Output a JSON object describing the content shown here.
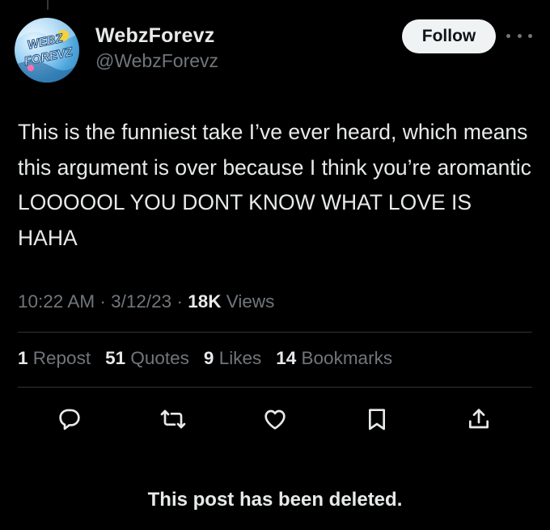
{
  "user": {
    "display_name": "WebzForevz",
    "handle": "@WebzForevz",
    "avatar_icon": "webzforevz-logo-avatar"
  },
  "follow_label": "Follow",
  "more_icon": "more-horizontal-icon",
  "tweet": {
    "text": "This is the funniest take I’ve ever heard, which means this argument is over because I think you’re aromantic LOOOOOL YOU DONT KNOW WHAT LOVE IS HAHA"
  },
  "meta": {
    "time": "10:22 AM",
    "separator": "·",
    "date": "3/12/23",
    "views_count": "18K",
    "views_label": "Views"
  },
  "stats": [
    {
      "count": "1",
      "label": "Repost"
    },
    {
      "count": "51",
      "label": "Quotes"
    },
    {
      "count": "9",
      "label": "Likes"
    },
    {
      "count": "14",
      "label": "Bookmarks"
    }
  ],
  "actions": [
    "reply-icon",
    "repost-icon",
    "like-icon",
    "bookmark-icon",
    "share-icon"
  ],
  "colors": {
    "background": "#000000",
    "text_primary": "#e7e9ea",
    "text_secondary": "#71767b",
    "divider": "#2f3336",
    "follow_bg": "#eff3f4"
  },
  "deleted_notice": "This post has been deleted."
}
